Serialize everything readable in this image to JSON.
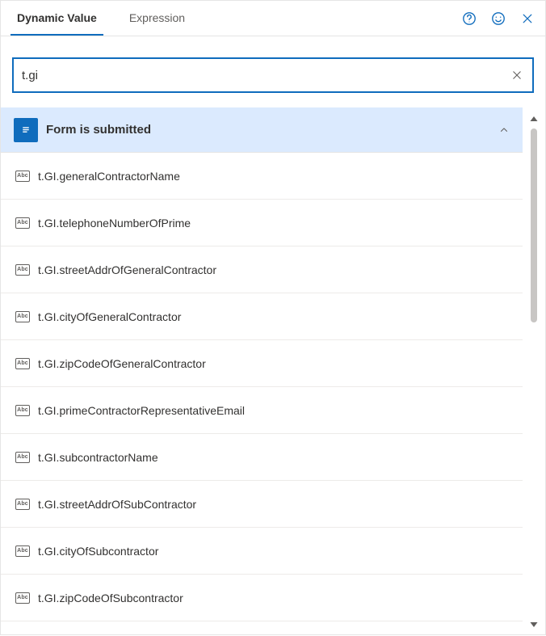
{
  "tabs": {
    "dynamic": "Dynamic Value",
    "expression": "Expression"
  },
  "search": {
    "value": "t.gi"
  },
  "group": {
    "title": "Form is submitted"
  },
  "items": [
    {
      "label": "t.GI.generalContractorName"
    },
    {
      "label": "t.GI.telephoneNumberOfPrime"
    },
    {
      "label": "t.GI.streetAddrOfGeneralContractor"
    },
    {
      "label": "t.GI.cityOfGeneralContractor"
    },
    {
      "label": "t.GI.zipCodeOfGeneralContractor"
    },
    {
      "label": "t.GI.primeContractorRepresentativeEmail"
    },
    {
      "label": "t.GI.subcontractorName"
    },
    {
      "label": "t.GI.streetAddrOfSubContractor"
    },
    {
      "label": "t.GI.cityOfSubcontractor"
    },
    {
      "label": "t.GI.zipCodeOfSubcontractor"
    }
  ]
}
